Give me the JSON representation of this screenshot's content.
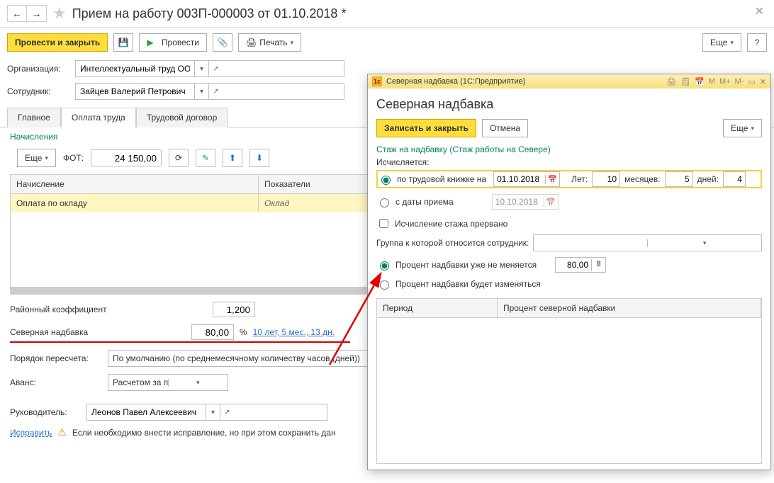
{
  "header": {
    "title": "Прием на работу 003П-000003 от 01.10.2018 *"
  },
  "toolbar": {
    "post_close": "Провести и закрыть",
    "post": "Провести",
    "print": "Печать",
    "more": "Еще",
    "help": "?"
  },
  "form": {
    "org_label": "Организация:",
    "org_value": "Интеллектуальный труд ООО",
    "emp_label": "Сотрудник:",
    "emp_value": "Зайцев Валерий Петрович"
  },
  "tabs": {
    "main": "Главное",
    "pay": "Оплата труда",
    "contract": "Трудовой договор"
  },
  "accruals": {
    "section": "Начисления",
    "more": "Еще",
    "fot_label": "ФОТ:",
    "fot_value": "24 150,00",
    "col_accrual": "Начисление",
    "col_indicators": "Показатели",
    "row_accrual": "Оплата по окладу",
    "row_indicator": "Оклад"
  },
  "summary": {
    "raion_label": "Районный коэффициент",
    "raion_value": "1,200",
    "sever_label": "Северная надбавка",
    "sever_value": "80,00",
    "percent": "%",
    "sever_link": "10 лет, 5 мес., 13 дн.",
    "recalc_label": "Порядок пересчета:",
    "recalc_value": "По умолчанию (по среднемесячному количеству часов (дней))",
    "avans_label": "Аванс:",
    "avans_value": "Расчетом за первую половину месяца"
  },
  "footer": {
    "ruk_label": "Руководитель:",
    "ruk_value": "Леонов Павел Алексеевич",
    "fix_link": "Исправить",
    "fix_text": "Если необходимо внести исправление, но при этом сохранить дан"
  },
  "dialog": {
    "wintitle": "Северная надбавка  (1С:Предприятие)",
    "title": "Северная надбавка",
    "save_close": "Записать и закрыть",
    "cancel": "Отмена",
    "more": "Еще",
    "link": "Стаж на надбавку (Стаж работы на Севере)",
    "calc_label": "Исчисляется:",
    "r1": "по трудовой книжке на",
    "r1_date": "01.10.2018",
    "years_label": "Лет:",
    "years": "10",
    "months_label": "месяцев:",
    "months": "5",
    "days_label": "дней:",
    "days": "4",
    "r2": "с даты приема",
    "r2_date": "10.10.2018",
    "chk": "Исчисление стажа прервано",
    "group_label": "Группа к которой относится сотрудник:",
    "p1": "Процент надбавки уже не меняется",
    "p1_val": "80,00",
    "p2": "Процент надбавки будет изменяться",
    "grid_col1": "Период",
    "grid_col2": "Процент северной надбавки"
  }
}
